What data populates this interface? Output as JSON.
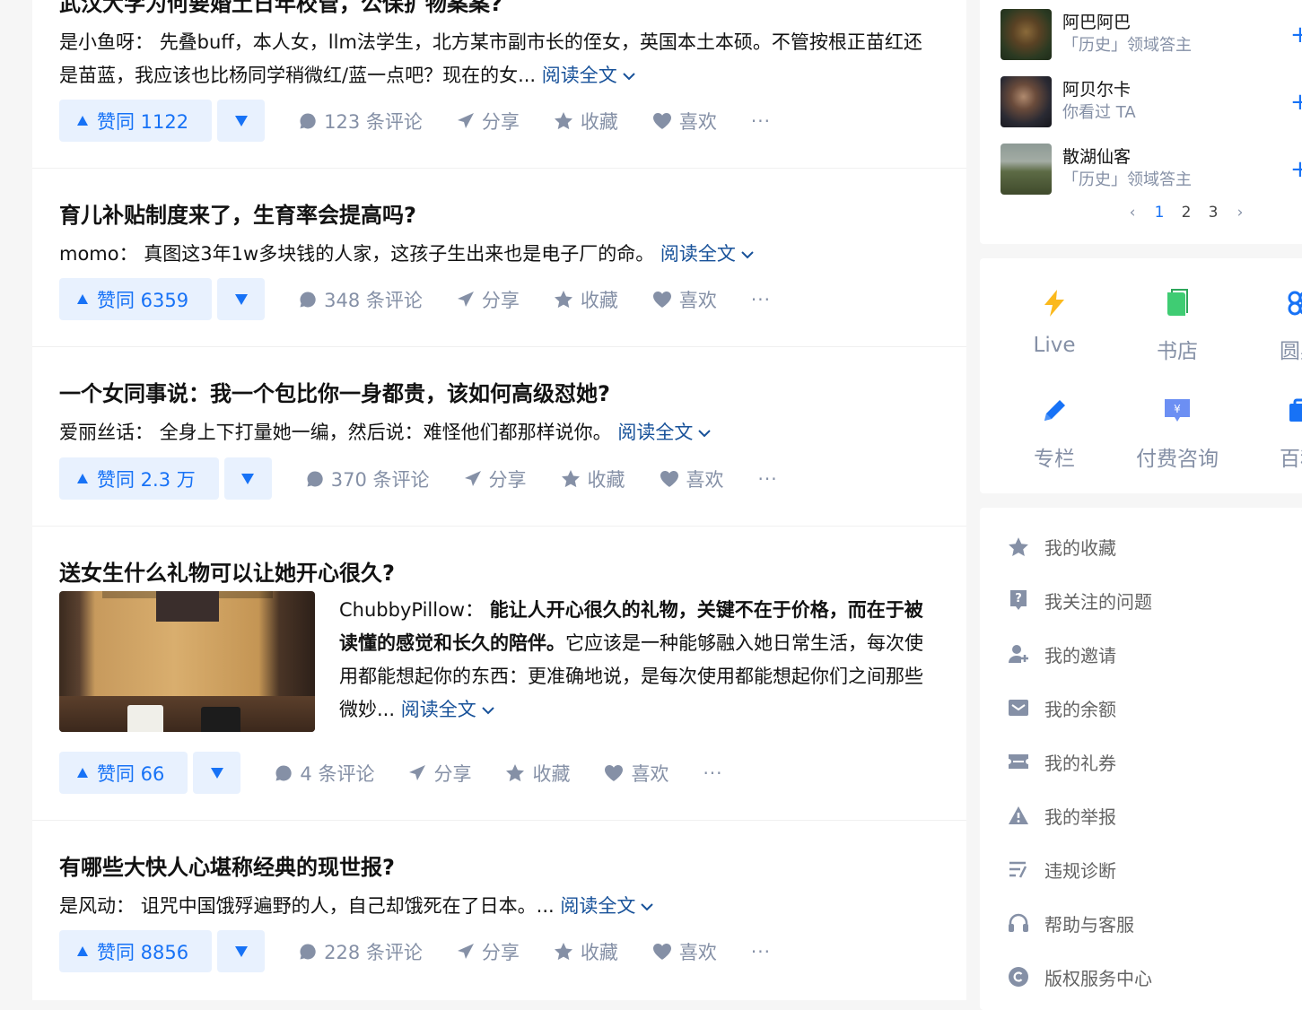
{
  "feed": {
    "cards": [
      {
        "title": "武汉大学为何要婚土日年校管，公保扩物案案?",
        "author": "是小鱼呀：",
        "text": "先叠buff，本人女，llm法学生，北方某市副市长的侄女，英国本土本硕。不管按根正苗红还是苗蓝，我应该也比杨同学稍微红/蓝一点吧？现在的女...",
        "read_more": "阅读全文",
        "vote": "赞同 1122",
        "comments": "123 条评论",
        "share": "分享",
        "collect": "收藏",
        "like": "喜欢",
        "more": "···"
      },
      {
        "title": "育儿补贴制度来了，生育率会提高吗?",
        "author": "momo：",
        "text": "真图这3年1w多块钱的人家，这孩子生出来也是电子厂的命。",
        "read_more": "阅读全文",
        "vote": "赞同 6359",
        "comments": "348 条评论",
        "share": "分享",
        "collect": "收藏",
        "like": "喜欢",
        "more": "···"
      },
      {
        "title": "一个女同事说：我一个包比你一身都贵，该如何高级怼她?",
        "author": "爱丽丝话：",
        "text": "全身上下打量她一编，然后说：难怪他们都那样说你。",
        "read_more": "阅读全文",
        "vote": "赞同 2.3 万",
        "comments": "370 条评论",
        "share": "分享",
        "collect": "收藏",
        "like": "喜欢",
        "more": "···"
      },
      {
        "title": "送女生什么礼物可以让她开心很久?",
        "author": "ChubbyPillow：",
        "text_bold": "能让人开心很久的礼物，关键不在于价格，而在于被读懂的感觉和长久的陪伴。",
        "text": "它应该是一种能够融入她日常生活，每次使用都能想起你的东西：更准确地说，是每次使用都能想起你们之间那些微妙...",
        "read_more": "阅读全文",
        "vote": "赞同 66",
        "comments": "4 条评论",
        "share": "分享",
        "collect": "收藏",
        "like": "喜欢",
        "more": "···"
      },
      {
        "title": "有哪些大快人心堪称经典的现世报?",
        "author": "是风动：",
        "text": "诅咒中国饿殍遍野的人，自己却饿死在了日本。...",
        "read_more": "阅读全文",
        "vote": "赞同 8856",
        "comments": "228 条评论",
        "share": "分享",
        "collect": "收藏",
        "like": "喜欢",
        "more": "···"
      }
    ]
  },
  "sidebar": {
    "recommend_users": [
      {
        "name": "阿巴阿巴",
        "desc": "「历史」领域答主",
        "follow": "+"
      },
      {
        "name": "阿贝尔卡",
        "desc": "你看过 TA",
        "follow": "+"
      },
      {
        "name": "散湖仙客",
        "desc": "「历史」领域答主",
        "follow": "+"
      }
    ],
    "pager": {
      "prev": "‹",
      "pages": [
        "1",
        "2",
        "3"
      ],
      "current": "1",
      "next": "›"
    },
    "tools": [
      {
        "label": "Live",
        "icon": "lightning-icon"
      },
      {
        "label": "书店",
        "icon": "book-icon"
      },
      {
        "label": "圆桌",
        "icon": "roundtable-icon"
      },
      {
        "label": "专栏",
        "icon": "pencil-icon"
      },
      {
        "label": "付费咨询",
        "icon": "paid-consult-icon"
      },
      {
        "label": "百科",
        "icon": "encyclopedia-icon"
      }
    ],
    "menu": [
      {
        "label": "我的收藏",
        "icon": "star-icon"
      },
      {
        "label": "我关注的问题",
        "icon": "question-icon"
      },
      {
        "label": "我的邀请",
        "icon": "invite-icon"
      },
      {
        "label": "我的余额",
        "icon": "wallet-icon"
      },
      {
        "label": "我的礼券",
        "icon": "coupon-icon"
      },
      {
        "label": "我的举报",
        "icon": "warning-icon"
      },
      {
        "label": "违规诊断",
        "icon": "diagnosis-icon"
      },
      {
        "label": "帮助与客服",
        "icon": "headset-icon"
      },
      {
        "label": "版权服务中心",
        "icon": "copyright-icon"
      }
    ]
  },
  "colors": {
    "accent": "#1772f6",
    "vote_bg": "#e8f1fe",
    "muted": "#8590a6",
    "link": "#175199"
  }
}
